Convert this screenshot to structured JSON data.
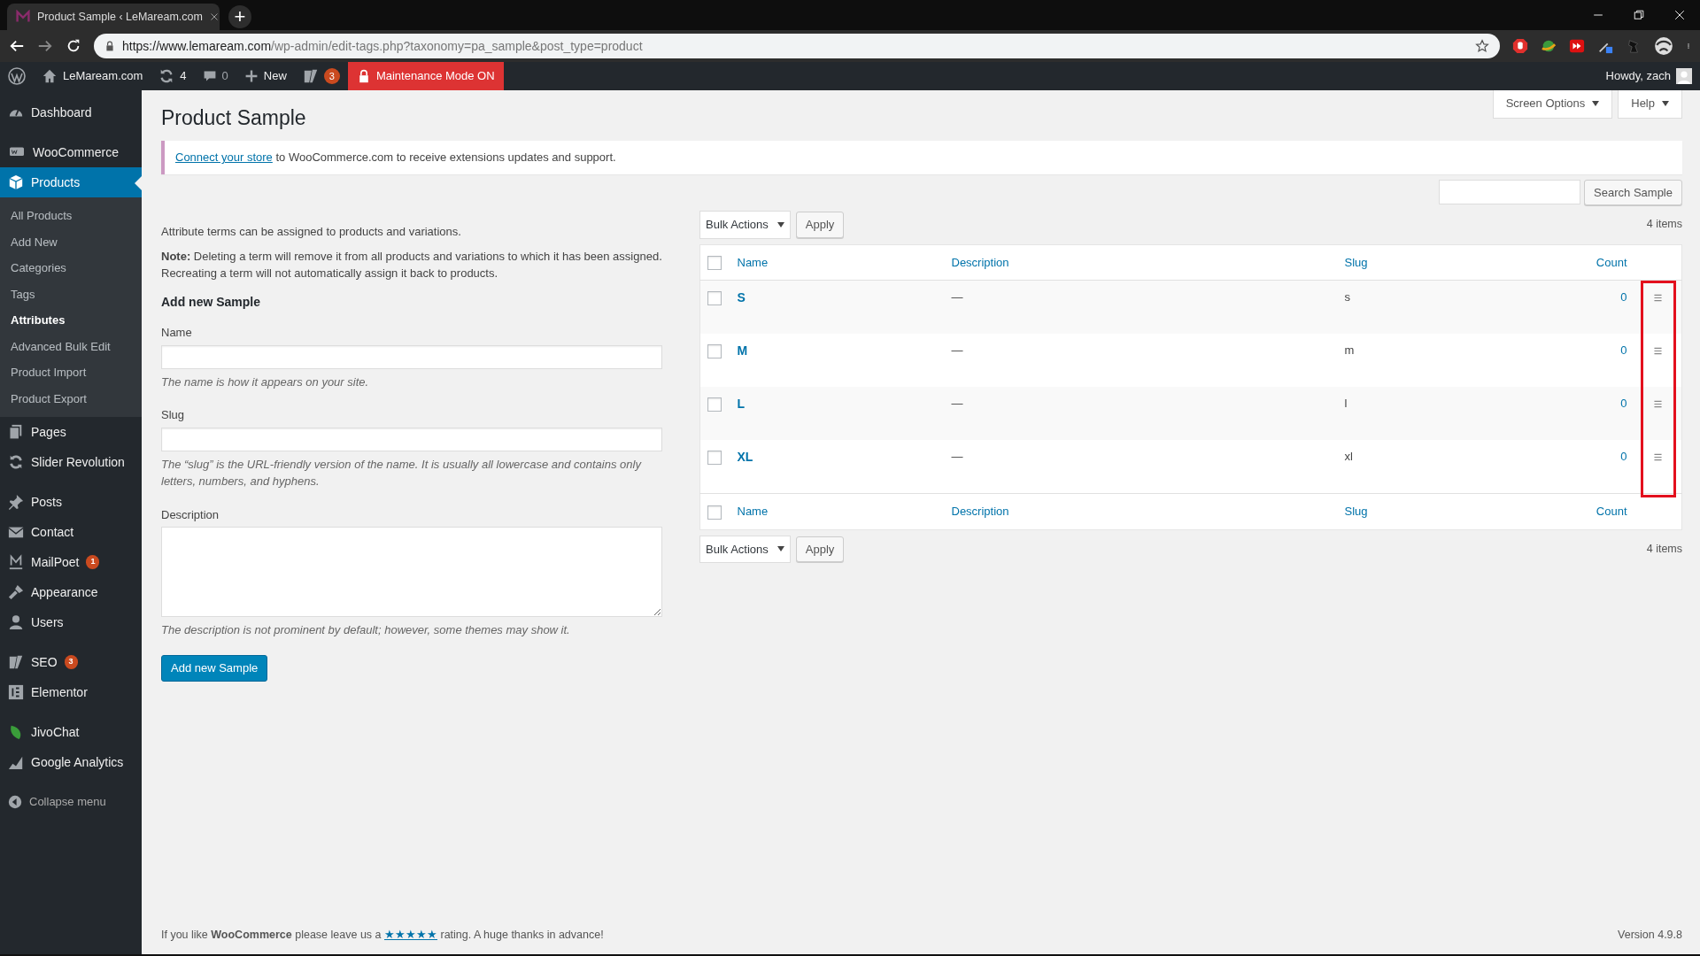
{
  "browser": {
    "tab_title": "Product Sample ‹ LeMaream.com",
    "new_tab": "+",
    "url_host": "https://www.lemaream.com",
    "url_path": "/wp-admin/edit-tags.php?taxonomy=pa_sample&post_type=product"
  },
  "admin_bar": {
    "site": "LeMaream.com",
    "updates": "4",
    "comments": "0",
    "new": "New",
    "seo_badge": "3",
    "maintenance": "Maintenance Mode ON",
    "greeting": "Howdy, zach"
  },
  "sidebar": {
    "groups": [
      [
        {
          "label": "Dashboard",
          "selected": false
        }
      ],
      [
        {
          "label": "WooCommerce",
          "selected": false
        },
        {
          "label": "Products",
          "selected": true,
          "children": [
            {
              "label": "All Products",
              "selected": false
            },
            {
              "label": "Add New",
              "selected": false
            },
            {
              "label": "Categories",
              "selected": false
            },
            {
              "label": "Tags",
              "selected": false
            },
            {
              "label": "Attributes",
              "selected": true
            },
            {
              "label": "Advanced Bulk Edit",
              "selected": false
            },
            {
              "label": "Product Import",
              "selected": false
            },
            {
              "label": "Product Export",
              "selected": false
            }
          ]
        },
        {
          "label": "Pages",
          "selected": false
        },
        {
          "label": "Slider Revolution",
          "selected": false
        }
      ],
      [
        {
          "label": "Posts",
          "selected": false
        },
        {
          "label": "Contact",
          "selected": false
        },
        {
          "label": "MailPoet",
          "selected": false,
          "badge": "1"
        },
        {
          "label": "Appearance",
          "selected": false
        },
        {
          "label": "Users",
          "selected": false
        }
      ],
      [
        {
          "label": "SEO",
          "selected": false,
          "badge": "3"
        },
        {
          "label": "Elementor",
          "selected": false
        }
      ],
      [
        {
          "label": "JivoChat",
          "selected": false
        },
        {
          "label": "Google Analytics",
          "selected": false
        }
      ]
    ],
    "collapse": "Collapse menu"
  },
  "screen_meta": [
    "Screen Options",
    "Help"
  ],
  "title": "Product Sample",
  "notice": {
    "link": "Connect your store",
    "text": " to WooCommerce.com to receive extensions updates and support."
  },
  "form": {
    "intro": "Attribute terms can be assigned to products and variations.",
    "note": "**Note:** Deleting a term will remove it from all products and variations to which it has been assigned. Recreating a term will not automatically assign it back to products.",
    "heading": "Add new Sample",
    "fields": [
      {
        "kind": "input",
        "label": "Name",
        "hint": "The name is how it appears on your site."
      },
      {
        "kind": "input",
        "label": "Slug",
        "hint": "The “slug” is the URL-friendly version of the name. It is usually all lowercase and contains only letters, numbers, and hyphens."
      },
      {
        "kind": "textarea",
        "label": "Description",
        "hint": "The description is not prominent by default; however, some themes may show it."
      }
    ],
    "submit": "Add new Sample"
  },
  "search": {
    "button": "Search Sample"
  },
  "top_nav": {
    "bulk": "Bulk Actions",
    "apply": "Apply",
    "count": "4 items"
  },
  "table": {
    "select_all_checked": false,
    "columns": [
      "Name",
      "Description",
      "Slug",
      "Count"
    ],
    "rows": [
      {
        "name": "S",
        "description": "—",
        "slug": "s",
        "count": "0",
        "checked": false
      },
      {
        "name": "M",
        "description": "—",
        "slug": "m",
        "count": "0",
        "checked": false
      },
      {
        "name": "L",
        "description": "—",
        "slug": "l",
        "count": "0",
        "checked": false
      },
      {
        "name": "XL",
        "description": "—",
        "slug": "xl",
        "count": "0",
        "checked": false
      }
    ],
    "footer_select_all_checked": false,
    "footer_columns": [
      "Name",
      "Description",
      "Slug",
      "Count"
    ]
  },
  "bottom_nav": {
    "bulk": "Bulk Actions",
    "apply": "Apply",
    "count": "4 items"
  },
  "annotation": {
    "kind": "frame"
  },
  "footer": {
    "text": "If you like **WooCommerce** please leave us a",
    "link": "★★★★★",
    "after": "rating. A huge thanks in advance!",
    "version": "Version 4.9.8"
  }
}
